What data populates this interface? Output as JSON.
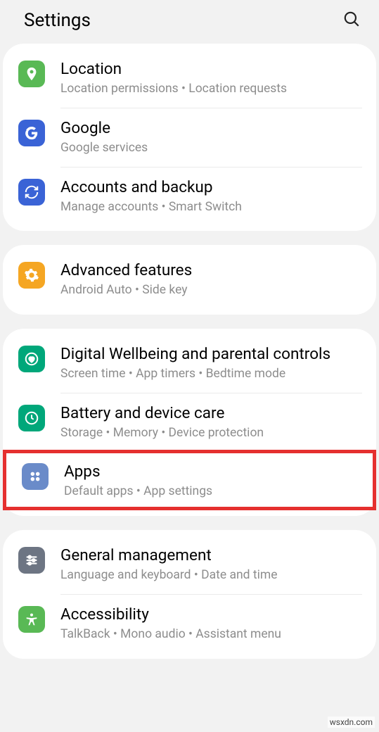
{
  "header": {
    "title": "Settings"
  },
  "groups": [
    {
      "items": [
        {
          "icon": "location-icon",
          "bg": "bg-green",
          "title": "Location",
          "sub": "Location permissions  •  Location requests"
        },
        {
          "icon": "google-icon",
          "bg": "bg-blue",
          "title": "Google",
          "sub": "Google services"
        },
        {
          "icon": "backup-icon",
          "bg": "bg-indigo",
          "title": "Accounts and backup",
          "sub": "Manage accounts  •  Smart Switch"
        }
      ]
    },
    {
      "items": [
        {
          "icon": "gear-icon",
          "bg": "bg-yellow",
          "title": "Advanced features",
          "sub": "Android Auto  •  Side key"
        }
      ]
    },
    {
      "items": [
        {
          "icon": "wellbeing-icon",
          "bg": "bg-teal",
          "title": "Digital Wellbeing and parental controls",
          "sub": "Screen time  •  App timers  •  Bedtime mode"
        },
        {
          "icon": "battery-icon",
          "bg": "bg-teal2",
          "title": "Battery and device care",
          "sub": "Storage  •  Memory  •  Device protection"
        },
        {
          "icon": "apps-icon",
          "bg": "bg-slate",
          "title": "Apps",
          "sub": "Default apps  •  App settings",
          "highlight": true
        }
      ]
    },
    {
      "items": [
        {
          "icon": "sliders-icon",
          "bg": "bg-gray",
          "title": "General management",
          "sub": "Language and keyboard  •  Date and time"
        },
        {
          "icon": "a11y-icon",
          "bg": "bg-lime",
          "title": "Accessibility",
          "sub": "TalkBack  •  Mono audio  •  Assistant menu"
        }
      ]
    }
  ],
  "watermark": "wsxdn.com"
}
